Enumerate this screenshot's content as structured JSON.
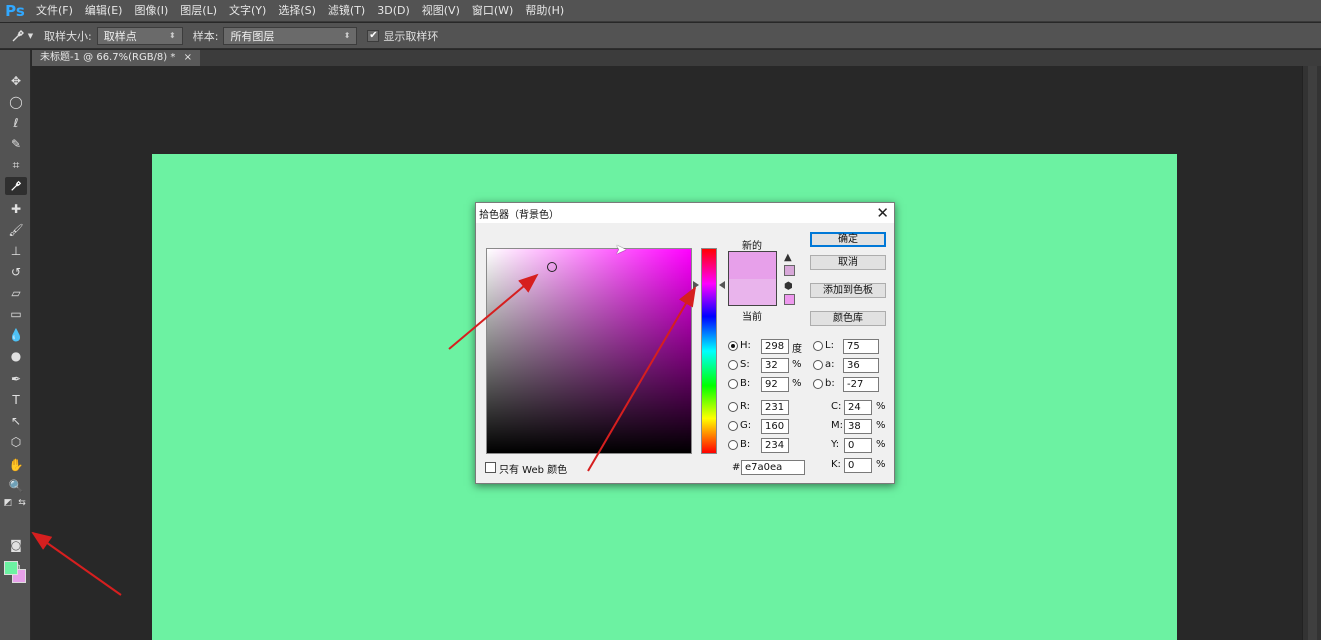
{
  "app": {
    "logo": "Ps"
  },
  "menu": [
    {
      "label": "文件(F)"
    },
    {
      "label": "编辑(E)"
    },
    {
      "label": "图像(I)"
    },
    {
      "label": "图层(L)"
    },
    {
      "label": "文字(Y)"
    },
    {
      "label": "选择(S)"
    },
    {
      "label": "滤镜(T)"
    },
    {
      "label": "3D(D)"
    },
    {
      "label": "视图(V)"
    },
    {
      "label": "窗口(W)"
    },
    {
      "label": "帮助(H)"
    }
  ],
  "options": {
    "sample_size_label": "取样大小:",
    "sample_size_value": "取样点",
    "sample_label": "样本:",
    "sample_value": "所有图层",
    "show_ring_label": "显示取样环",
    "show_ring_checked": "✔"
  },
  "document": {
    "tab_title": "未标题-1 @ 66.7%(RGB/8) *",
    "tab_close": "×",
    "canvas_color": "#6cf2a2"
  },
  "swatches": {
    "foreground": "#6cf2a2",
    "background": "#e7a0ea"
  },
  "dialog": {
    "title": "拾色器（背景色）",
    "close": "✕",
    "label_new": "新的",
    "label_current": "当前",
    "web_only_label": "只有 Web 颜色",
    "buttons": {
      "ok": "确定",
      "cancel": "取消",
      "add_swatch": "添加到色板",
      "libraries": "颜色库"
    },
    "hsb": {
      "h": {
        "label": "H:",
        "value": "298",
        "unit": "度"
      },
      "s": {
        "label": "S:",
        "value": "32",
        "unit": "%"
      },
      "b": {
        "label": "B:",
        "value": "92",
        "unit": "%"
      }
    },
    "rgb": {
      "r": {
        "label": "R:",
        "value": "231"
      },
      "g": {
        "label": "G:",
        "value": "160"
      },
      "b": {
        "label": "B:",
        "value": "234"
      }
    },
    "lab": {
      "l": {
        "label": "L:",
        "value": "75"
      },
      "a": {
        "label": "a:",
        "value": "36"
      },
      "b": {
        "label": "b:",
        "value": "-27"
      }
    },
    "cmyk": {
      "c": {
        "label": "C:",
        "value": "24",
        "unit": "%"
      },
      "m": {
        "label": "M:",
        "value": "38",
        "unit": "%"
      },
      "y": {
        "label": "Y:",
        "value": "0",
        "unit": "%"
      },
      "k": {
        "label": "K:",
        "value": "0",
        "unit": "%"
      }
    },
    "hex": {
      "label": "#",
      "value": "e7a0ea"
    },
    "new_color": "#e7a0ea",
    "current_color": "#e9b4ec"
  },
  "icons": {
    "eyedropper": "eyedropper-icon",
    "warning": "warning-icon",
    "cube": "cube-icon"
  },
  "annotation_color": "#d61f1f"
}
